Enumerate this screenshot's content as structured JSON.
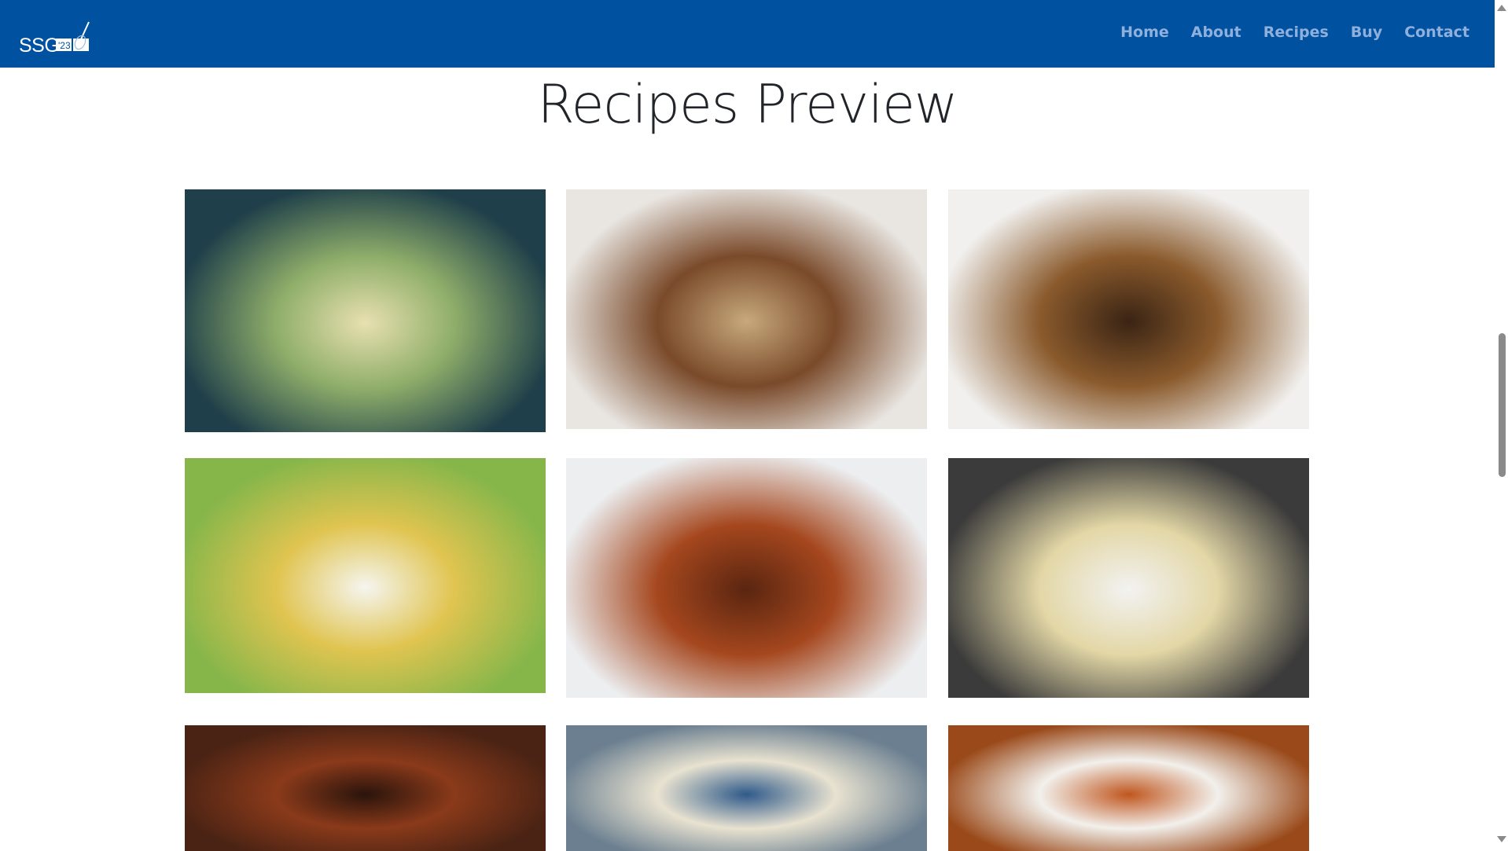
{
  "brand": {
    "logo_text": "SSG",
    "logo_badge": "'23"
  },
  "nav": {
    "items": [
      {
        "label": "Home"
      },
      {
        "label": "About"
      },
      {
        "label": "Recipes"
      },
      {
        "label": "Buy"
      },
      {
        "label": "Contact"
      }
    ]
  },
  "page": {
    "title": "Recipes Preview"
  },
  "recipes": [
    {
      "image": "salad-with-pecans",
      "colors": [
        "#1f3f4a",
        "#8fae6a",
        "#e8e0b0"
      ]
    },
    {
      "image": "banana-bread",
      "colors": [
        "#e9e6e2",
        "#7a4a2a",
        "#c7a97c"
      ]
    },
    {
      "image": "oat-energy-balls",
      "colors": [
        "#f1f0ee",
        "#8a5a2c",
        "#3a2414"
      ]
    },
    {
      "image": "rice-pilaf",
      "colors": [
        "#86b64a",
        "#e0c450",
        "#f5f5f0"
      ]
    },
    {
      "image": "fried-jalapeno-poppers",
      "colors": [
        "#eceef0",
        "#a5471e",
        "#5a2510"
      ]
    },
    {
      "image": "momo-dumplings",
      "colors": [
        "#3b3b3b",
        "#e3d7a6",
        "#f2f2f2"
      ]
    },
    {
      "image": "bbq-ribs",
      "colors": [
        "#4a2314",
        "#8a3a1a",
        "#2a140c"
      ]
    },
    {
      "image": "tacos",
      "colors": [
        "#6b7f90",
        "#e8e2d0",
        "#2f5a8a"
      ]
    },
    {
      "image": "samosa-with-sauce",
      "colors": [
        "#9a4a1a",
        "#f2f0ec",
        "#c0561e"
      ]
    }
  ]
}
